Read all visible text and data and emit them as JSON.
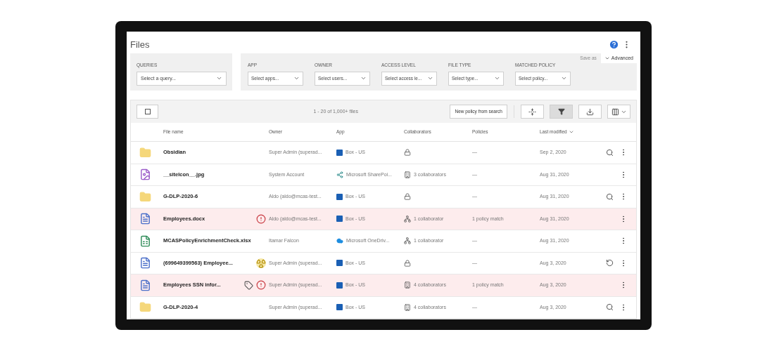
{
  "page": {
    "title": "Files"
  },
  "filters": {
    "queries": {
      "label": "QUERIES",
      "placeholder": "Select a query..."
    },
    "fields": [
      {
        "label": "APP",
        "placeholder": "Select apps..."
      },
      {
        "label": "OWNER",
        "placeholder": "Select users..."
      },
      {
        "label": "ACCESS LEVEL",
        "placeholder": "Select access le..."
      },
      {
        "label": "FILE TYPE",
        "placeholder": "Select type..."
      },
      {
        "label": "MATCHED POLICY",
        "placeholder": "Select policy..."
      }
    ],
    "save_as": {
      "label": "Save as",
      "disabled": true
    },
    "advanced": {
      "label": "Advanced"
    }
  },
  "toolbar": {
    "select_all": {
      "checked": false
    },
    "count": "1 - 20 of 1,000+ files",
    "new_policy": "New policy from search",
    "tools": [
      {
        "kind": "collapse",
        "selected": false
      },
      {
        "kind": "filter",
        "selected": true
      },
      {
        "kind": "download",
        "selected": false
      },
      {
        "kind": "columns",
        "selected": false
      }
    ]
  },
  "table": {
    "columns": [
      "File name",
      "Owner",
      "App",
      "Collaborators",
      "Policies",
      "Last modified"
    ],
    "rows": [
      {
        "icon": {
          "kind": "folder"
        },
        "name": "Obsidian",
        "badges": [],
        "owner": "Super Admin (superad...",
        "app": {
          "kind": "box",
          "name": "Box - US"
        },
        "collab": {
          "kind": "private"
        },
        "policy": "—",
        "modified": "Sep 2, 2020",
        "actions": [
          {
            "kind": "search"
          },
          {
            "kind": "more"
          }
        ],
        "flagged": false
      },
      {
        "icon": {
          "kind": "image"
        },
        "name": "__siteIcon__.jpg",
        "badges": [],
        "owner": "System Account",
        "app": {
          "kind": "sharepoint",
          "name": "Microsoft SharePoi..."
        },
        "collab": {
          "kind": "internal",
          "text": "3 collaborators"
        },
        "policy": "—",
        "modified": "Aug 31, 2020",
        "actions": [
          {
            "kind": "more"
          }
        ],
        "flagged": false
      },
      {
        "icon": {
          "kind": "folder"
        },
        "name": "G-DLP-2020-6",
        "badges": [],
        "owner": "Aldo (aldo@mcas-test...",
        "app": {
          "kind": "box",
          "name": "Box - US"
        },
        "collab": {
          "kind": "private"
        },
        "policy": "—",
        "modified": "Aug 31, 2020",
        "actions": [
          {
            "kind": "search"
          },
          {
            "kind": "more"
          }
        ],
        "flagged": false
      },
      {
        "icon": {
          "kind": "doc"
        },
        "name": "Employees.docx",
        "badges": [
          {
            "kind": "alert"
          }
        ],
        "owner": "Aldo (aldo@mcas-test...",
        "app": {
          "kind": "box",
          "name": "Box - US"
        },
        "collab": {
          "kind": "external",
          "text": "1 collaborator"
        },
        "policy": "1 policy match",
        "modified": "Aug 31, 2020",
        "actions": [
          {
            "kind": "more"
          }
        ],
        "flagged": true
      },
      {
        "icon": {
          "kind": "sheet"
        },
        "name": "MCASPolicyEnrichmentCheck.xlsx",
        "badges": [],
        "owner": "Itamar Falcon",
        "app": {
          "kind": "onedrive",
          "name": "Microsoft OneDriv..."
        },
        "collab": {
          "kind": "external",
          "text": "1 collaborator"
        },
        "policy": "—",
        "modified": "Aug 31, 2020",
        "actions": [
          {
            "kind": "more"
          }
        ],
        "flagged": false
      },
      {
        "icon": {
          "kind": "doc"
        },
        "name": "(699649399563) Employee...",
        "badges": [
          {
            "kind": "quarantine"
          }
        ],
        "owner": "Super Admin (superad...",
        "app": {
          "kind": "box",
          "name": "Box - US"
        },
        "collab": {
          "kind": "private"
        },
        "policy": "—",
        "modified": "Aug 3, 2020",
        "actions": [
          {
            "kind": "restore"
          },
          {
            "kind": "more"
          }
        ],
        "flagged": false
      },
      {
        "icon": {
          "kind": "doc"
        },
        "name": "Employees SSN infor...",
        "badges": [
          {
            "kind": "label"
          },
          {
            "kind": "alert"
          }
        ],
        "owner": "Super Admin (superad...",
        "app": {
          "kind": "box",
          "name": "Box - US"
        },
        "collab": {
          "kind": "internal",
          "text": "4 collaborators"
        },
        "policy": "1 policy match",
        "modified": "Aug 3, 2020",
        "actions": [
          {
            "kind": "more"
          }
        ],
        "flagged": true
      },
      {
        "icon": {
          "kind": "folder"
        },
        "name": "G-DLP-2020-4",
        "badges": [],
        "owner": "Super Admin (superad...",
        "app": {
          "kind": "box",
          "name": "Box - US"
        },
        "collab": {
          "kind": "internal",
          "text": "4 collaborators"
        },
        "policy": "—",
        "modified": "Aug 3, 2020",
        "actions": [
          {
            "kind": "search"
          },
          {
            "kind": "more"
          }
        ],
        "flagged": false
      }
    ]
  }
}
